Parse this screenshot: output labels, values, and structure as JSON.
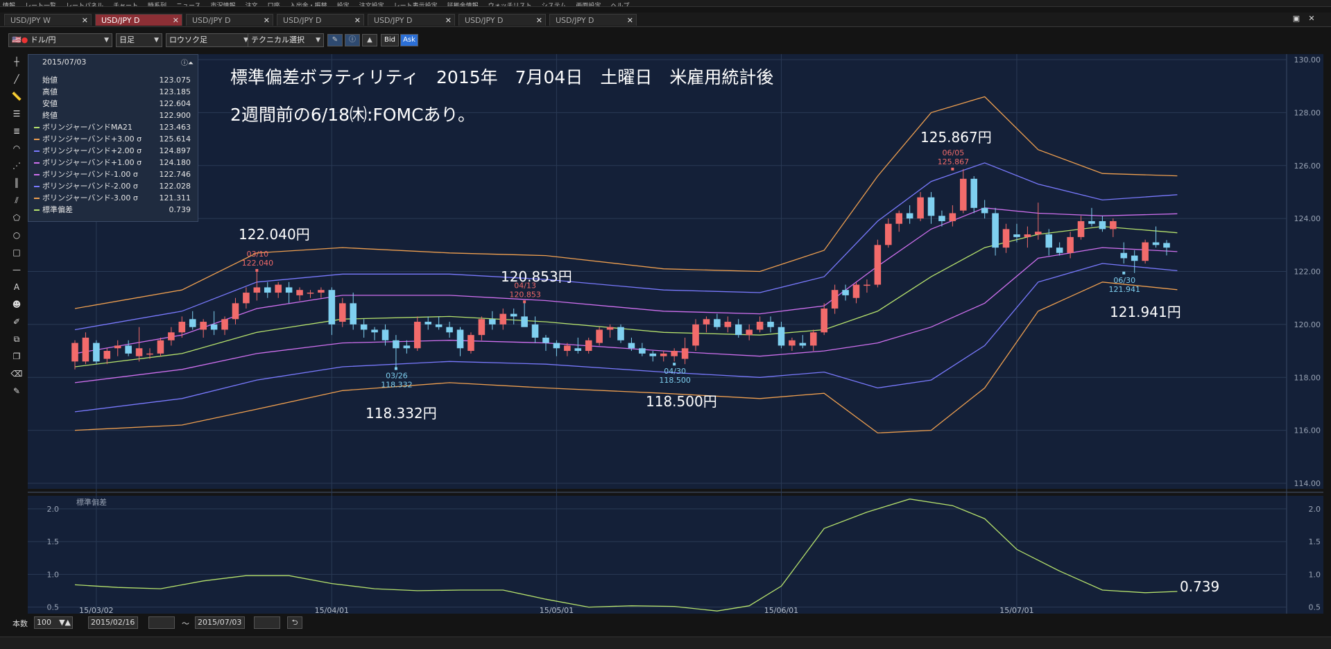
{
  "menu": [
    "情報",
    "レート一覧",
    "レートパネル",
    "チャート",
    "時系列",
    "ニュース",
    "市況情報",
    "注文",
    "口座",
    "入出金・振替",
    "設定",
    "注文設定",
    "レート表示設定",
    "証拠金情報",
    "ウォッチリスト",
    "システム",
    "画面設定",
    "ヘルプ"
  ],
  "tabs": [
    {
      "label": "USD/JPY W",
      "active": false
    },
    {
      "label": "USD/JPY D",
      "active": true
    },
    {
      "label": "USD/JPY D",
      "active": false
    },
    {
      "label": "USD/JPY D",
      "active": false
    },
    {
      "label": "USD/JPY D",
      "active": false
    },
    {
      "label": "USD/JPY D",
      "active": false
    },
    {
      "label": "USD/JPY D",
      "active": false
    }
  ],
  "tab_close_glyph": "✕",
  "window_controls": {
    "restore": "▣",
    "close": "✕"
  },
  "toolbar": {
    "pair": "ドル/円",
    "timeframe": "日足",
    "chart_style": "ロウソク足",
    "technical": "テクニカル選択",
    "bid": "Bid",
    "ask": "Ask"
  },
  "info_panel": {
    "date": "2015/07/03",
    "rows": [
      {
        "label": "始値",
        "value": "123.075",
        "color": ""
      },
      {
        "label": "高値",
        "value": "123.185",
        "color": ""
      },
      {
        "label": "安値",
        "value": "122.604",
        "color": ""
      },
      {
        "label": "終値",
        "value": "122.900",
        "color": ""
      },
      {
        "label": "ボリンジャーバンドMA21",
        "value": "123.463",
        "color": "#b7e36d"
      },
      {
        "label": "ボリンジャーバンド+3.00 σ",
        "value": "125.614",
        "color": "#f0a050"
      },
      {
        "label": "ボリンジャーバンド+2.00 σ",
        "value": "124.897",
        "color": "#7a7aff"
      },
      {
        "label": "ボリンジャーバンド+1.00 σ",
        "value": "124.180",
        "color": "#d070f0"
      },
      {
        "label": "ボリンジャーバンド-1.00 σ",
        "value": "122.746",
        "color": "#d070f0"
      },
      {
        "label": "ボリンジャーバンド-2.00 σ",
        "value": "122.028",
        "color": "#7a7aff"
      },
      {
        "label": "ボリンジャーバンド-3.00 σ",
        "value": "121.311",
        "color": "#f0a050"
      },
      {
        "label": "標準偏差",
        "value": "0.739",
        "color": "#b7e36d"
      }
    ]
  },
  "annotations": {
    "title_line1": "標準偏差ボラティリティ　2015年　7月04日　土曜日　米雇用統計後",
    "title_line2": "2週間前の6/18㈭:FOMCあり。",
    "peak1": "122.040円",
    "trough1": "118.332円",
    "peak2": "120.853円",
    "trough2": "118.500円",
    "peak3": "125.867円",
    "trough3": "121.941円",
    "sd_last": "0.739",
    "mark_0310_date": "03/10",
    "mark_0310_val": "122.040",
    "mark_0326_date": "03/26",
    "mark_0326_val": "118.332",
    "mark_0413_date": "04/13",
    "mark_0413_val": "120.853",
    "mark_0430_date": "04/30",
    "mark_0430_val": "118.500",
    "mark_0605_date": "06/05",
    "mark_0605_val": "125.867",
    "mark_0630_date": "06/30",
    "mark_0630_val": "121.941"
  },
  "chart_data": {
    "type": "candlestick",
    "price_axis": {
      "ylim": [
        114,
        130
      ],
      "ticks": [
        "130.00",
        "128.00",
        "126.00",
        "124.00",
        "122.00",
        "120.00",
        "118.00",
        "116.00",
        "114.00"
      ]
    },
    "x_ticks": [
      {
        "label": "15/03/02",
        "index": 2
      },
      {
        "label": "15/04/01",
        "index": 24
      },
      {
        "label": "15/05/01",
        "index": 45
      },
      {
        "label": "15/06/01",
        "index": 66
      },
      {
        "label": "15/07/01",
        "index": 88
      }
    ],
    "colors": {
      "up": "#f26b6b",
      "down": "#7fd0f0",
      "ma": "#b7e36d",
      "sigma1": "#d070f0",
      "sigma2": "#7a7aff",
      "sigma3": "#f0a050",
      "sd": "#b7e36d",
      "background": "#142038",
      "grid": "#2a3a55"
    },
    "candles": [
      {
        "o": 118.6,
        "h": 119.4,
        "l": 118.3,
        "c": 119.3
      },
      {
        "o": 118.6,
        "h": 119.7,
        "l": 118.5,
        "c": 119.5
      },
      {
        "o": 119.3,
        "h": 119.4,
        "l": 118.5,
        "c": 118.6
      },
      {
        "o": 118.7,
        "h": 119.1,
        "l": 118.5,
        "c": 119.0
      },
      {
        "o": 119.1,
        "h": 119.4,
        "l": 118.8,
        "c": 119.2
      },
      {
        "o": 119.2,
        "h": 119.4,
        "l": 118.8,
        "c": 118.9
      },
      {
        "o": 118.8,
        "h": 119.9,
        "l": 118.6,
        "c": 119.1
      },
      {
        "o": 118.9,
        "h": 119.1,
        "l": 118.7,
        "c": 118.9
      },
      {
        "o": 118.9,
        "h": 119.5,
        "l": 118.8,
        "c": 119.4
      },
      {
        "o": 119.4,
        "h": 119.9,
        "l": 119.2,
        "c": 119.7
      },
      {
        "o": 119.7,
        "h": 120.3,
        "l": 119.5,
        "c": 120.1
      },
      {
        "o": 120.2,
        "h": 120.5,
        "l": 119.8,
        "c": 119.9
      },
      {
        "o": 119.8,
        "h": 120.2,
        "l": 119.5,
        "c": 120.1
      },
      {
        "o": 120.0,
        "h": 120.5,
        "l": 119.6,
        "c": 119.8
      },
      {
        "o": 119.8,
        "h": 120.3,
        "l": 119.6,
        "c": 120.2
      },
      {
        "o": 120.2,
        "h": 121.0,
        "l": 120.0,
        "c": 120.8
      },
      {
        "o": 120.8,
        "h": 121.4,
        "l": 120.6,
        "c": 121.2
      },
      {
        "o": 121.2,
        "h": 122.04,
        "l": 120.9,
        "c": 121.4
      },
      {
        "o": 121.4,
        "h": 121.6,
        "l": 121.0,
        "c": 121.2
      },
      {
        "o": 121.2,
        "h": 121.6,
        "l": 121.0,
        "c": 121.5
      },
      {
        "o": 121.4,
        "h": 121.6,
        "l": 120.8,
        "c": 121.2
      },
      {
        "o": 121.1,
        "h": 121.4,
        "l": 120.9,
        "c": 121.3
      },
      {
        "o": 121.2,
        "h": 121.3,
        "l": 121.0,
        "c": 121.2
      },
      {
        "o": 121.2,
        "h": 121.4,
        "l": 121.0,
        "c": 121.3
      },
      {
        "o": 121.3,
        "h": 121.4,
        "l": 119.6,
        "c": 120.0
      },
      {
        "o": 120.1,
        "h": 121.0,
        "l": 119.9,
        "c": 120.8
      },
      {
        "o": 120.8,
        "h": 121.2,
        "l": 119.8,
        "c": 120.0
      },
      {
        "o": 120.0,
        "h": 120.2,
        "l": 119.5,
        "c": 119.8
      },
      {
        "o": 119.8,
        "h": 119.9,
        "l": 119.4,
        "c": 119.7
      },
      {
        "o": 119.8,
        "h": 120.0,
        "l": 119.2,
        "c": 119.4
      },
      {
        "o": 119.4,
        "h": 119.6,
        "l": 118.332,
        "c": 119.1
      },
      {
        "o": 119.2,
        "h": 119.4,
        "l": 118.9,
        "c": 119.1
      },
      {
        "o": 119.1,
        "h": 120.3,
        "l": 119.0,
        "c": 120.1
      },
      {
        "o": 120.1,
        "h": 120.3,
        "l": 119.8,
        "c": 120.0
      },
      {
        "o": 120.0,
        "h": 120.3,
        "l": 119.8,
        "c": 119.9
      },
      {
        "o": 119.9,
        "h": 120.1,
        "l": 119.5,
        "c": 119.7
      },
      {
        "o": 119.8,
        "h": 119.9,
        "l": 118.8,
        "c": 119.1
      },
      {
        "o": 119.0,
        "h": 119.7,
        "l": 118.9,
        "c": 119.6
      },
      {
        "o": 119.6,
        "h": 120.3,
        "l": 119.4,
        "c": 120.2
      },
      {
        "o": 120.2,
        "h": 120.5,
        "l": 119.8,
        "c": 120.0
      },
      {
        "o": 120.0,
        "h": 120.6,
        "l": 119.8,
        "c": 120.4
      },
      {
        "o": 120.4,
        "h": 120.6,
        "l": 120.0,
        "c": 120.3
      },
      {
        "o": 120.3,
        "h": 120.853,
        "l": 120.1,
        "c": 119.9
      },
      {
        "o": 120.0,
        "h": 120.3,
        "l": 119.3,
        "c": 119.5
      },
      {
        "o": 119.5,
        "h": 119.6,
        "l": 119.0,
        "c": 119.3
      },
      {
        "o": 119.3,
        "h": 119.4,
        "l": 118.8,
        "c": 119.1
      },
      {
        "o": 119.0,
        "h": 119.3,
        "l": 118.8,
        "c": 119.2
      },
      {
        "o": 119.1,
        "h": 119.5,
        "l": 118.9,
        "c": 119.0
      },
      {
        "o": 119.0,
        "h": 119.5,
        "l": 118.9,
        "c": 119.4
      },
      {
        "o": 119.3,
        "h": 119.9,
        "l": 119.2,
        "c": 119.8
      },
      {
        "o": 119.8,
        "h": 120.0,
        "l": 119.5,
        "c": 119.9
      },
      {
        "o": 119.9,
        "h": 120.0,
        "l": 119.3,
        "c": 119.4
      },
      {
        "o": 119.3,
        "h": 119.5,
        "l": 119.0,
        "c": 119.1
      },
      {
        "o": 119.1,
        "h": 119.3,
        "l": 118.8,
        "c": 118.9
      },
      {
        "o": 118.9,
        "h": 119.0,
        "l": 118.6,
        "c": 118.8
      },
      {
        "o": 118.8,
        "h": 119.0,
        "l": 118.6,
        "c": 118.9
      },
      {
        "o": 118.8,
        "h": 119.1,
        "l": 118.6,
        "c": 119.0
      },
      {
        "o": 118.7,
        "h": 119.5,
        "l": 118.5,
        "c": 119.1
      },
      {
        "o": 119.2,
        "h": 120.2,
        "l": 119.0,
        "c": 120.0
      },
      {
        "o": 120.0,
        "h": 120.3,
        "l": 119.7,
        "c": 120.2
      },
      {
        "o": 120.2,
        "h": 120.4,
        "l": 119.8,
        "c": 119.9
      },
      {
        "o": 119.9,
        "h": 120.3,
        "l": 119.7,
        "c": 120.1
      },
      {
        "o": 120.0,
        "h": 120.2,
        "l": 119.5,
        "c": 119.6
      },
      {
        "o": 119.6,
        "h": 120.0,
        "l": 119.4,
        "c": 119.8
      },
      {
        "o": 119.8,
        "h": 120.3,
        "l": 119.7,
        "c": 120.1
      },
      {
        "o": 120.1,
        "h": 120.3,
        "l": 119.7,
        "c": 119.9
      },
      {
        "o": 119.9,
        "h": 120.1,
        "l": 119.1,
        "c": 119.2
      },
      {
        "o": 119.2,
        "h": 119.5,
        "l": 119.0,
        "c": 119.4
      },
      {
        "o": 119.3,
        "h": 119.6,
        "l": 119.1,
        "c": 119.2
      },
      {
        "o": 119.2,
        "h": 119.8,
        "l": 119.0,
        "c": 119.7
      },
      {
        "o": 119.7,
        "h": 120.8,
        "l": 119.6,
        "c": 120.6
      },
      {
        "o": 120.6,
        "h": 121.5,
        "l": 120.4,
        "c": 121.3
      },
      {
        "o": 121.3,
        "h": 121.5,
        "l": 120.9,
        "c": 121.1
      },
      {
        "o": 121.0,
        "h": 121.6,
        "l": 120.8,
        "c": 121.5
      },
      {
        "o": 121.5,
        "h": 121.7,
        "l": 121.2,
        "c": 121.5
      },
      {
        "o": 121.5,
        "h": 123.2,
        "l": 121.4,
        "c": 123.0
      },
      {
        "o": 123.0,
        "h": 124.0,
        "l": 122.9,
        "c": 123.8
      },
      {
        "o": 123.8,
        "h": 124.3,
        "l": 123.5,
        "c": 124.2
      },
      {
        "o": 124.2,
        "h": 124.5,
        "l": 123.8,
        "c": 124.0
      },
      {
        "o": 124.0,
        "h": 125.0,
        "l": 123.9,
        "c": 124.8
      },
      {
        "o": 124.8,
        "h": 125.0,
        "l": 123.8,
        "c": 124.1
      },
      {
        "o": 124.1,
        "h": 124.3,
        "l": 123.7,
        "c": 123.9
      },
      {
        "o": 123.9,
        "h": 124.5,
        "l": 123.7,
        "c": 124.2
      },
      {
        "o": 124.3,
        "h": 125.867,
        "l": 124.2,
        "c": 125.5
      },
      {
        "o": 125.5,
        "h": 125.6,
        "l": 124.2,
        "c": 124.4
      },
      {
        "o": 124.4,
        "h": 124.7,
        "l": 124.0,
        "c": 124.2
      },
      {
        "o": 124.2,
        "h": 124.4,
        "l": 122.6,
        "c": 122.9
      },
      {
        "o": 122.9,
        "h": 123.8,
        "l": 122.7,
        "c": 123.6
      },
      {
        "o": 123.4,
        "h": 123.8,
        "l": 123.1,
        "c": 123.3
      },
      {
        "o": 123.3,
        "h": 123.7,
        "l": 122.9,
        "c": 123.4
      },
      {
        "o": 123.4,
        "h": 124.6,
        "l": 123.2,
        "c": 123.5
      },
      {
        "o": 123.4,
        "h": 123.6,
        "l": 122.6,
        "c": 122.9
      },
      {
        "o": 122.9,
        "h": 123.1,
        "l": 122.6,
        "c": 122.7
      },
      {
        "o": 122.7,
        "h": 123.5,
        "l": 122.5,
        "c": 123.3
      },
      {
        "o": 123.3,
        "h": 124.1,
        "l": 123.2,
        "c": 123.9
      },
      {
        "o": 123.9,
        "h": 124.4,
        "l": 123.7,
        "c": 123.8
      },
      {
        "o": 123.9,
        "h": 124.1,
        "l": 123.5,
        "c": 123.6
      },
      {
        "o": 123.6,
        "h": 124.0,
        "l": 123.3,
        "c": 123.9
      },
      {
        "o": 122.7,
        "h": 123.1,
        "l": 122.3,
        "c": 122.5
      },
      {
        "o": 122.6,
        "h": 122.8,
        "l": 121.941,
        "c": 122.4
      },
      {
        "o": 122.4,
        "h": 123.2,
        "l": 122.3,
        "c": 123.1
      },
      {
        "o": 123.1,
        "h": 123.7,
        "l": 122.9,
        "c": 123.0
      },
      {
        "o": 123.075,
        "h": 123.185,
        "l": 122.604,
        "c": 122.9
      }
    ],
    "bands": {
      "ma21": {
        "x": [
          0,
          10,
          17,
          25,
          35,
          44,
          55,
          64,
          70,
          75,
          80,
          85,
          90,
          96,
          103
        ],
        "y": [
          118.4,
          118.9,
          119.7,
          120.2,
          120.3,
          120.1,
          119.7,
          119.6,
          119.8,
          120.5,
          121.8,
          122.9,
          123.4,
          123.7,
          123.46
        ]
      },
      "upper1": {
        "x": [
          0,
          10,
          17,
          25,
          35,
          44,
          55,
          64,
          70,
          75,
          80,
          85,
          90,
          96,
          103
        ],
        "y": [
          118.9,
          119.6,
          120.6,
          121.1,
          121.1,
          120.9,
          120.5,
          120.4,
          120.7,
          122.2,
          123.6,
          124.4,
          124.2,
          124.1,
          124.18
        ]
      },
      "upper2": {
        "x": [
          0,
          10,
          17,
          25,
          35,
          44,
          55,
          64,
          70,
          75,
          80,
          85,
          90,
          96,
          103
        ],
        "y": [
          119.8,
          120.5,
          121.6,
          121.9,
          121.9,
          121.7,
          121.3,
          121.2,
          121.8,
          123.9,
          125.4,
          126.1,
          125.3,
          124.7,
          124.9
        ]
      },
      "upper3": {
        "x": [
          0,
          10,
          17,
          25,
          35,
          44,
          55,
          64,
          70,
          75,
          80,
          85,
          90,
          96,
          103
        ],
        "y": [
          120.6,
          121.3,
          122.7,
          122.9,
          122.7,
          122.6,
          122.1,
          122.0,
          122.8,
          125.6,
          128.0,
          128.6,
          126.6,
          125.7,
          125.61
        ]
      },
      "lower1": {
        "x": [
          0,
          10,
          17,
          25,
          35,
          44,
          55,
          64,
          70,
          75,
          80,
          85,
          90,
          96,
          103
        ],
        "y": [
          117.8,
          118.3,
          118.9,
          119.3,
          119.4,
          119.3,
          119.0,
          118.8,
          119.0,
          119.3,
          119.9,
          120.8,
          122.5,
          122.9,
          122.75
        ]
      },
      "lower2": {
        "x": [
          0,
          10,
          17,
          25,
          35,
          44,
          55,
          64,
          70,
          75,
          80,
          85,
          90,
          96,
          103
        ],
        "y": [
          116.7,
          117.2,
          117.9,
          118.4,
          118.6,
          118.5,
          118.2,
          118.0,
          118.2,
          117.6,
          117.9,
          119.2,
          121.6,
          122.3,
          122.03
        ]
      },
      "lower3": {
        "x": [
          0,
          10,
          17,
          25,
          35,
          44,
          55,
          64,
          70,
          75,
          80,
          85,
          90,
          96,
          103
        ],
        "y": [
          116.0,
          116.2,
          116.8,
          117.5,
          117.8,
          117.6,
          117.4,
          117.2,
          117.4,
          115.9,
          116.0,
          117.6,
          120.5,
          121.6,
          121.31
        ]
      }
    },
    "sd_panel": {
      "label": "標準偏差",
      "ylim": [
        0.4,
        2.2
      ],
      "ticks": [
        "2.0",
        "1.5",
        "1.0",
        "0.5"
      ],
      "x": [
        0,
        4,
        8,
        12,
        16,
        20,
        24,
        28,
        32,
        36,
        40,
        44,
        48,
        52,
        56,
        60,
        63,
        66,
        70,
        74,
        78,
        82,
        85,
        88,
        92,
        96,
        100,
        103
      ],
      "y": [
        0.84,
        0.8,
        0.78,
        0.9,
        0.98,
        0.98,
        0.86,
        0.78,
        0.75,
        0.76,
        0.76,
        0.62,
        0.5,
        0.52,
        0.51,
        0.44,
        0.52,
        0.82,
        1.7,
        1.95,
        2.15,
        2.05,
        1.85,
        1.38,
        1.05,
        0.76,
        0.72,
        0.739
      ]
    }
  },
  "bottom": {
    "count_label": "本数",
    "count_value": "100",
    "from_date": "2015/02/16",
    "tilde": "～",
    "to_date": "2015/07/03"
  }
}
